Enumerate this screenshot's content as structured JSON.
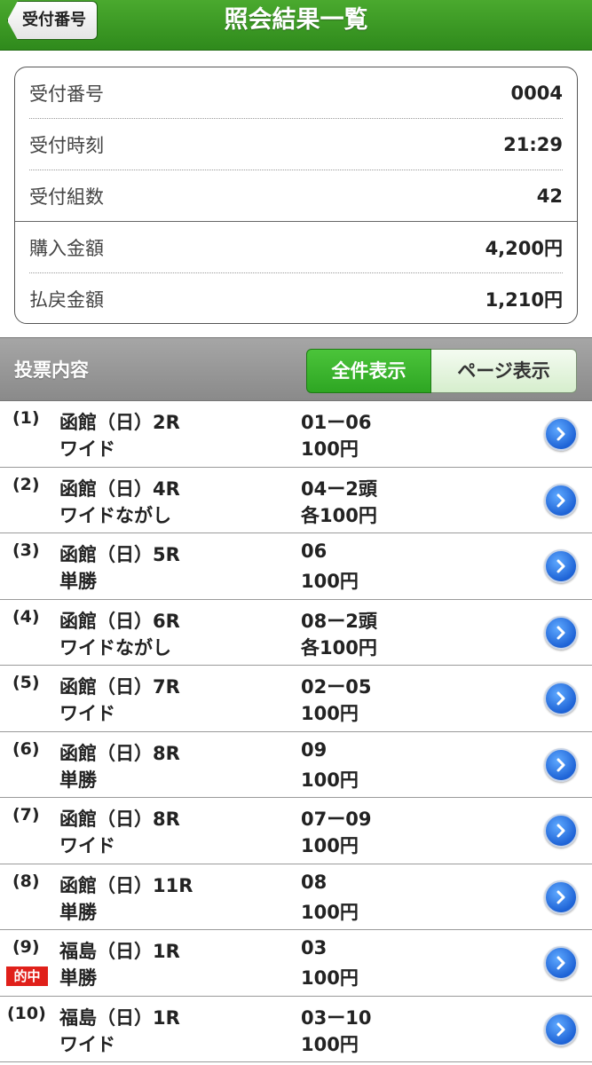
{
  "header": {
    "title": "照会結果一覧",
    "back_label": "受付番号"
  },
  "summary": {
    "rows": [
      {
        "label": "受付番号",
        "value": "0004"
      },
      {
        "label": "受付時刻",
        "value": "21:29"
      },
      {
        "label": "受付組数",
        "value": "42"
      },
      {
        "label": "購入金額",
        "value": "4,200円"
      },
      {
        "label": "払戻金額",
        "value": "1,210円"
      }
    ]
  },
  "section": {
    "title": "投票内容",
    "segment_all": "全件表示",
    "segment_page": "ページ表示"
  },
  "hit_badge": "的中",
  "items": [
    {
      "num": "(1)",
      "race": "函館（日）2R",
      "bet": "ワイド",
      "combo": "01ー06",
      "amount": "100円"
    },
    {
      "num": "(2)",
      "race": "函館（日）4R",
      "bet": "ワイドながし",
      "combo": "04ー2頭",
      "amount": "各100円"
    },
    {
      "num": "(3)",
      "race": "函館（日）5R",
      "bet": "単勝",
      "combo": "06",
      "amount": "100円"
    },
    {
      "num": "(4)",
      "race": "函館（日）6R",
      "bet": "ワイドながし",
      "combo": "08ー2頭",
      "amount": "各100円"
    },
    {
      "num": "(5)",
      "race": "函館（日）7R",
      "bet": "ワイド",
      "combo": "02ー05",
      "amount": "100円"
    },
    {
      "num": "(6)",
      "race": "函館（日）8R",
      "bet": "単勝",
      "combo": "09",
      "amount": "100円"
    },
    {
      "num": "(7)",
      "race": "函館（日）8R",
      "bet": "ワイド",
      "combo": "07ー09",
      "amount": "100円"
    },
    {
      "num": "(8)",
      "race": "函館（日）11R",
      "bet": "単勝",
      "combo": "08",
      "amount": "100円"
    },
    {
      "num": "(9)",
      "race": "福島（日）1R",
      "bet": "単勝",
      "combo": "03",
      "amount": "100円"
    },
    {
      "num": "(10)",
      "race": "福島（日）1R",
      "bet": "ワイド",
      "combo": "03ー10",
      "amount": "100円"
    }
  ]
}
